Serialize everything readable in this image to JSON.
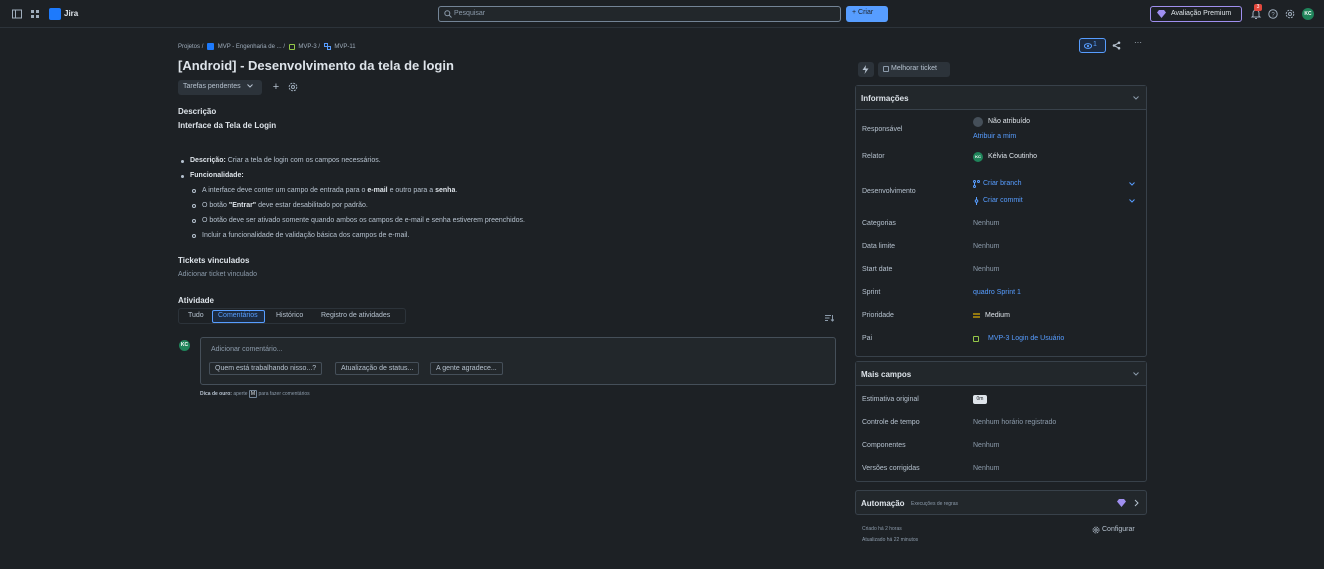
{
  "topbar": {
    "app_name": "Jira",
    "search_placeholder": "Pesquisar",
    "create_label": "+ Criar",
    "premium_label": "Avaliação Premium",
    "notif_count": "3",
    "user_initials": "KC"
  },
  "breadcrumb": {
    "projects": "Projetos",
    "project": "MVP - Engenharia de ...",
    "epic": "MVP-3",
    "issue": "MVP-11",
    "sep": "/"
  },
  "issue": {
    "title": "[Android] - Desenvolvimento da tela de login",
    "status": "Tarefas pendentes",
    "description_label": "Descrição",
    "description_heading": "Interface da Tela de Login",
    "bullets": {
      "desc_label": "Descrição:",
      "desc_text": "Criar a tela de login com os campos necessários.",
      "func_label": "Funcionalidade:",
      "sub1_a": "A interface deve conter um campo de entrada para o",
      "sub1_b": "e-mail",
      "sub1_c": "e outro para a",
      "sub1_d": "senha",
      "sub1_e": ".",
      "sub2_a": "O botão",
      "sub2_b": "\"Entrar\"",
      "sub2_c": "deve estar desabilitado por padrão.",
      "sub3": "O botão deve ser ativado somente quando ambos os campos de e-mail e senha estiverem preenchidos.",
      "sub4": "Incluir a funcionalidade de validação básica dos campos de e-mail."
    },
    "linked_label": "Tickets vinculados",
    "linked_add": "Adicionar ticket vinculado",
    "activity_label": "Atividade"
  },
  "activity": {
    "tabs": [
      "Tudo",
      "Comentários",
      "Histórico",
      "Registro de atividades"
    ],
    "comment_placeholder": "Adicionar comentário...",
    "chips": [
      "Quem está trabalhando nisso...?",
      "Atualização de status...",
      "A gente agradece..."
    ],
    "tip_bold": "Dica de ouro:",
    "tip_a": "aperte",
    "tip_key": "M",
    "tip_b": "para fazer comentários"
  },
  "actions": {
    "watch_count": "1",
    "more": "···",
    "improve": "Melhorar ticket"
  },
  "details": {
    "title": "Informações",
    "assignee_label": "Responsável",
    "assignee_value": "Não atribuído",
    "assign_me": "Atribuir a mim",
    "reporter_label": "Relator",
    "reporter_value": "Kélvia Coutinho",
    "reporter_initials": "KC",
    "dev_label": "Desenvolvimento",
    "create_branch": "Criar branch",
    "create_commit": "Criar commit",
    "categories_label": "Categorias",
    "categories_value": "Nenhum",
    "due_label": "Data limite",
    "due_value": "Nenhum",
    "start_label": "Start date",
    "start_value": "Nenhum",
    "sprint_label": "Sprint",
    "sprint_value": "quadro Sprint 1",
    "priority_label": "Prioridade",
    "priority_value": "Medium",
    "parent_label": "Pai",
    "parent_value": "MVP-3 Login de Usuário"
  },
  "more_fields": {
    "title": "Mais campos",
    "estimate_label": "Estimativa original",
    "estimate_value": "0m",
    "time_label": "Controle de tempo",
    "time_value": "Nenhum horário registrado",
    "components_label": "Componentes",
    "components_value": "Nenhum",
    "fixed_label": "Versões corrigidas",
    "fixed_value": "Nenhum"
  },
  "automation": {
    "title": "Automação",
    "subtitle": "Execuções de regras"
  },
  "footer": {
    "created": "Criado há 2 horas",
    "updated": "Atualizado há 22 minutos",
    "configure": "Configurar"
  },
  "colors": {
    "accent": "#579dff",
    "background": "#1d2125",
    "avatar": "#1f845a",
    "premium": "#9f8fef",
    "priority": "#e2b203"
  }
}
